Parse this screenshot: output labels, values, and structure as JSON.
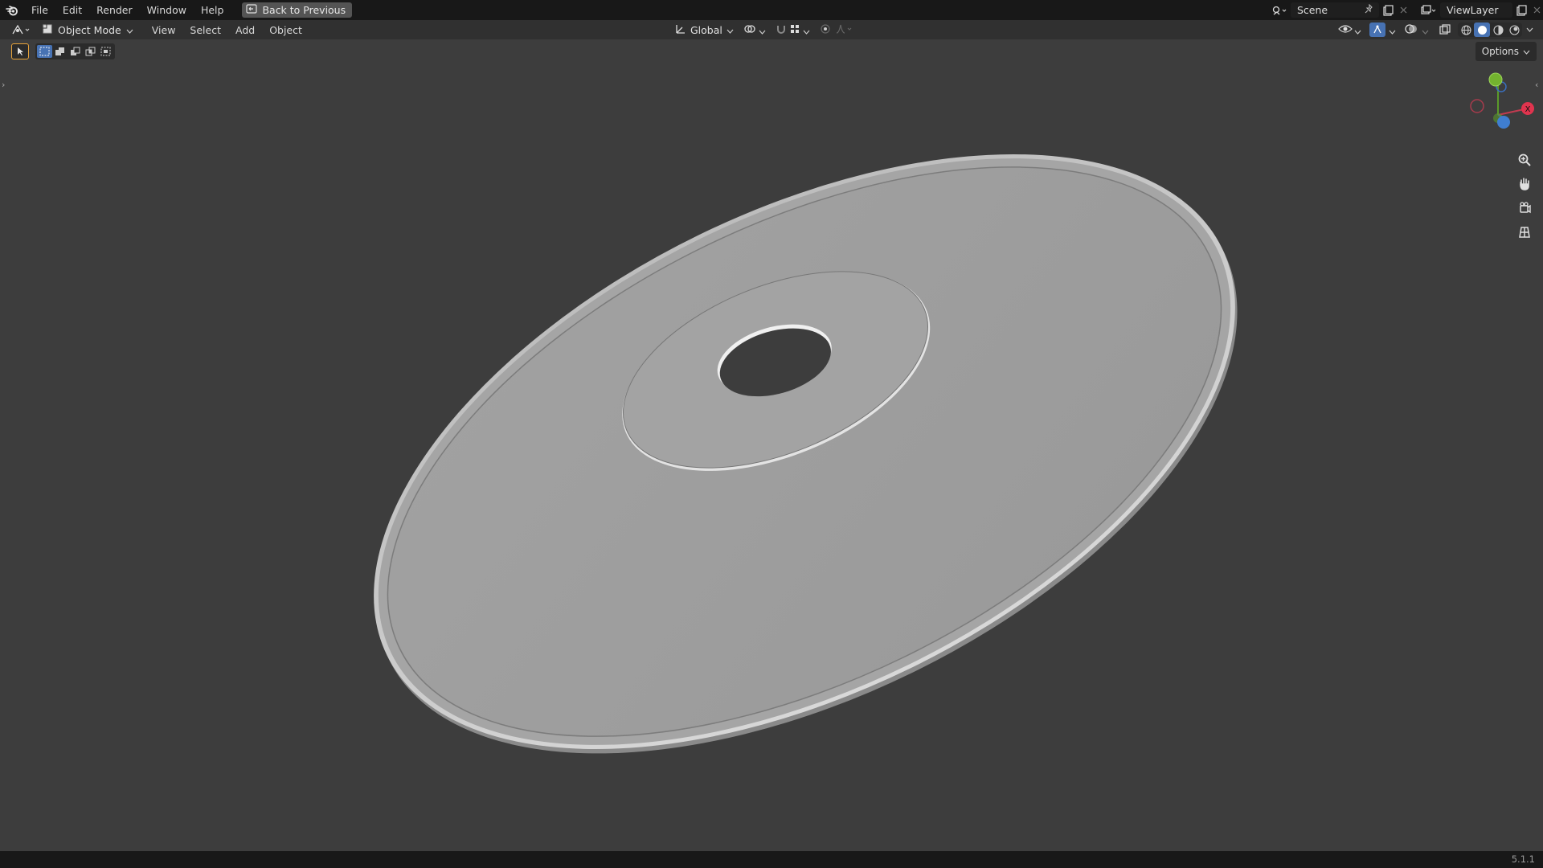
{
  "topbar": {
    "menus": [
      "File",
      "Edit",
      "Render",
      "Window",
      "Help"
    ],
    "back_button": "Back to Previous",
    "scene": "Scene",
    "view_layer": "ViewLayer"
  },
  "header": {
    "mode": "Object Mode",
    "menus": [
      "View",
      "Select",
      "Add",
      "Object"
    ],
    "transform_orientation": "Global"
  },
  "toolrow": {
    "options": "Options"
  },
  "gizmo": {
    "x_label": "X"
  },
  "status": {
    "version": "5.1.1"
  },
  "colors": {
    "viewport_bg": "#3d3d3d",
    "disc_surface": "#9e9e9e",
    "accent_blue": "#4772b3"
  },
  "icons": [
    "blender-logo-icon",
    "back-icon",
    "scene-icon",
    "pin-icon",
    "new-scene-icon",
    "close-icon",
    "viewlayer-icon",
    "editor-type-icon",
    "object-mode-icon",
    "transform-orientation-icon",
    "pivot-icon",
    "snap-icon",
    "proportional-icon",
    "falloff-icon",
    "visibility-icon",
    "gizmo-icon",
    "overlay-icon",
    "xray-icon",
    "wireframe-icon",
    "solid-icon",
    "material-icon",
    "rendered-icon",
    "select-tool-icon",
    "zoom-icon",
    "hand-icon",
    "camera-icon",
    "grid-icon"
  ]
}
